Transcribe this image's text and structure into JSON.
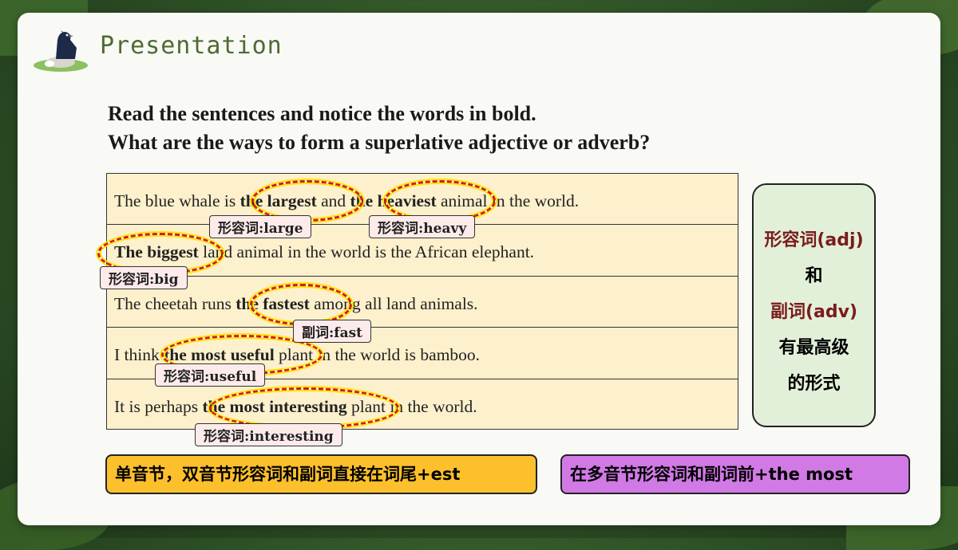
{
  "slide": {
    "title": "Presentation",
    "question_line1": "Read the sentences and notice the words in bold.",
    "question_line2": "What are the ways to form a superlative adjective or adverb?"
  },
  "rows": [
    {
      "pre": "The blue whale is ",
      "b1": "the largest",
      "mid": " and ",
      "b2": "the heaviest",
      "post": " animal in the world.",
      "tag1": "形容词:large",
      "tag2": "形容词:heavy"
    },
    {
      "b1": "The biggest",
      "post": " land animal in the world is the African elephant.",
      "tag1": "形容词:big"
    },
    {
      "pre": "The cheetah runs ",
      "b1": "the fastest",
      "post": " among all land animals.",
      "tag1": "副词:fast"
    },
    {
      "pre": "I think ",
      "b1": "the most useful",
      "post": " plant in the world is bamboo.",
      "tag1": "形容词:useful"
    },
    {
      "pre": "It is perhaps ",
      "b1": "the most interesting",
      "post": " plant in the world.",
      "tag1": "形容词:interesting"
    }
  ],
  "sidebox": {
    "line1": "形容词(adj)",
    "line2": "和",
    "line3": "副词(adv)",
    "line4": "有最高级",
    "line5": "的形式"
  },
  "bottom": {
    "left": "单音节，双音节形容词和副词直接在词尾+est",
    "right": "在多音节形容词和副词前+the most"
  },
  "colors": {
    "left_bar": "#fcc02c",
    "right_bar": "#d17ae6",
    "table_bg": "#fdf0cc",
    "title": "#4d6b32"
  }
}
